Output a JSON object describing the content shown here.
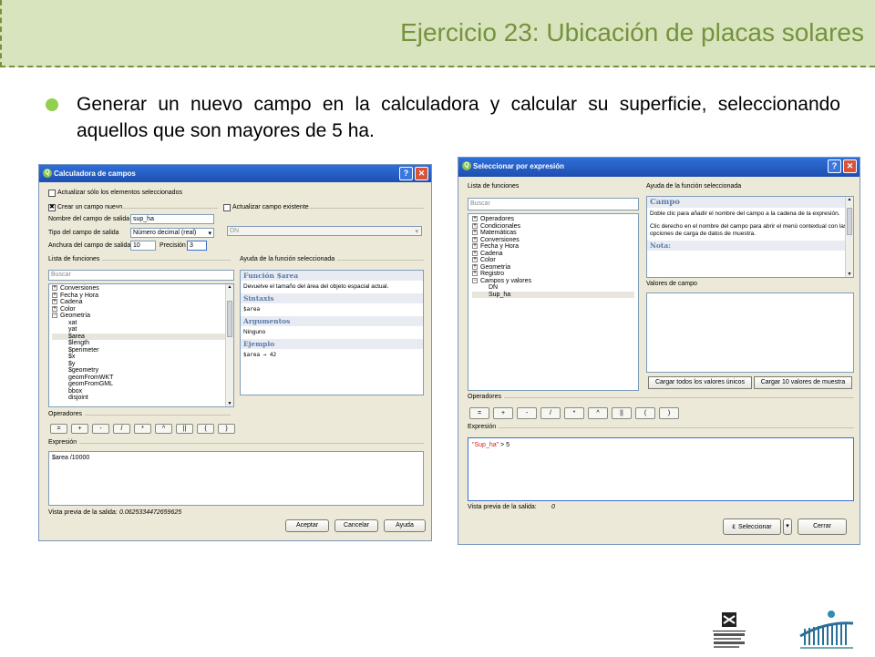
{
  "slide": {
    "title": "Ejercicio 23: Ubicación de placas solares",
    "bullet": "Generar un nuevo campo en la calculadora y calcular su superficie, seleccionando aquellos que son mayores de 5 ha."
  },
  "calc": {
    "title": "Calculadora de campos",
    "only_selected": "Actualizar sólo los elementos seleccionados",
    "create_new": "Crear un campo nuevo",
    "update_existing": "Actualizar campo existente",
    "out_name_label": "Nombre del campo de salida",
    "out_name_value": "sup_ha",
    "out_type_label": "Tipo del campo de salida",
    "out_type_value": "Número decimal (real)",
    "out_width_label": "Anchura del campo de salida",
    "out_width_value": "10",
    "precision_label": "Precisión",
    "precision_value": "3",
    "existing_field": "DN",
    "func_list_label": "Lista de funciones",
    "search_placeholder": "Buscar",
    "func_items": [
      {
        "t": "Conversiones",
        "e": "+"
      },
      {
        "t": "Fecha y Hora",
        "e": "+"
      },
      {
        "t": "Cadena",
        "e": "+"
      },
      {
        "t": "Color",
        "e": "+"
      },
      {
        "t": "Geometría",
        "e": "−"
      },
      {
        "t": "xat"
      },
      {
        "t": "yat"
      },
      {
        "t": "$area",
        "sel": true
      },
      {
        "t": "$length"
      },
      {
        "t": "$perimeter"
      },
      {
        "t": "$x"
      },
      {
        "t": "$y"
      },
      {
        "t": "$geometry"
      },
      {
        "t": "geomFromWKT"
      },
      {
        "t": "geomFromGML"
      },
      {
        "t": "bbox"
      },
      {
        "t": "disjoint"
      }
    ],
    "help_label": "Ayuda de la función seleccionada",
    "help_title": "Función $area",
    "help_desc": "Devuelve el tamaño del área del objeto espacial actual.",
    "help_syntax_h": "Sintaxis",
    "help_syntax": "$area",
    "help_args_h": "Argumentos",
    "help_args": "Ninguno",
    "help_example_h": "Ejemplo",
    "help_example": "$area → 42",
    "operators_label": "Operadores",
    "operators": [
      "=",
      "+",
      "-",
      "/",
      "*",
      "^",
      "||",
      "(",
      ")"
    ],
    "expression_label": "Expresión",
    "expression": "$area /10000",
    "preview_label": "Vista previa de la salida:",
    "preview_value": "0.0625334472659625",
    "ok": "Aceptar",
    "cancel": "Cancelar",
    "help": "Ayuda"
  },
  "sel": {
    "title": "Seleccionar por expresión",
    "func_list_label": "Lista de funciones",
    "search_placeholder": "Buscar",
    "func_items": [
      {
        "t": "Operadores",
        "e": "+"
      },
      {
        "t": "Condicionales",
        "e": "+"
      },
      {
        "t": "Matemáticas",
        "e": "+"
      },
      {
        "t": "Conversiones",
        "e": "+"
      },
      {
        "t": "Fecha y Hora",
        "e": "+"
      },
      {
        "t": "Cadena",
        "e": "+"
      },
      {
        "t": "Color",
        "e": "+"
      },
      {
        "t": "Geometría",
        "e": "+"
      },
      {
        "t": "Registro",
        "e": "+"
      },
      {
        "t": "Campos y valores",
        "e": "−"
      },
      {
        "t": "DN"
      },
      {
        "t": "Sup_ha",
        "sel": true
      }
    ],
    "help_label": "Ayuda de la función seleccionada",
    "help_title": "Campo",
    "help_p1": "Doble clic para añadir el nombre del campo a la cadena de la expresión.",
    "help_p2": "Clic derecho en el nombre del campo para abrir el menú contextual con las opciones de carga de datos de muestra.",
    "help_note": "Nota:",
    "values_label": "Valores de campo",
    "load_all": "Cargar todos los valores únicos",
    "load_10": "Cargar 10 valores de muestra",
    "operators_label": "Operadores",
    "operators": [
      "=",
      "+",
      "-",
      "/",
      "*",
      "^",
      "||",
      "(",
      ")"
    ],
    "expression_label": "Expresión",
    "expression_field": "\"Sup_ha\"",
    "expression_rest": " > 5",
    "preview_label": "Vista previa de la salida:",
    "preview_value": "0",
    "select": "Seleccionar",
    "close": "Cerrar"
  },
  "logos": {
    "ehu_line1": "Universidad",
    "ehu_line2": "del País Vasco",
    "ehu_line3": "Euskal Herriko",
    "ehu_line4": "Unibertsitatea"
  },
  "colors": {
    "header_bg": "#d7e4bd",
    "header_text": "#76923c",
    "bullet": "#92d050",
    "titlebar": "#1e4fb0"
  }
}
